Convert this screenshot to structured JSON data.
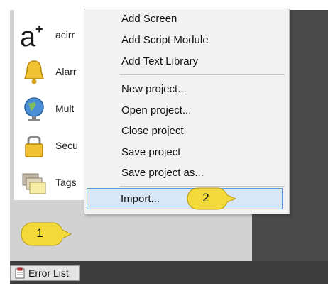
{
  "sidebar": {
    "items": [
      {
        "label": "acirr",
        "icon": "a-plus-icon"
      },
      {
        "label": "Alarr",
        "icon": "bell-icon"
      },
      {
        "label": "Mult",
        "icon": "globe-icon"
      },
      {
        "label": "Secu",
        "icon": "lock-icon"
      },
      {
        "label": "Tags",
        "icon": "folders-icon"
      }
    ]
  },
  "context_menu": {
    "group1": [
      "Add Screen",
      "Add Script Module",
      "Add Text Library"
    ],
    "group2": [
      "New project...",
      "Open project...",
      "Close project",
      "Save project",
      "Save project as..."
    ],
    "import_label": "Import..."
  },
  "callouts": {
    "one": "1",
    "two": "2"
  },
  "bottom_tab": {
    "label": "Error List",
    "icon": "clipboard-icon"
  },
  "colors": {
    "highlight": "#d7e7f7",
    "highlight_border": "#5b98d6",
    "callout": "#f4d93a"
  }
}
